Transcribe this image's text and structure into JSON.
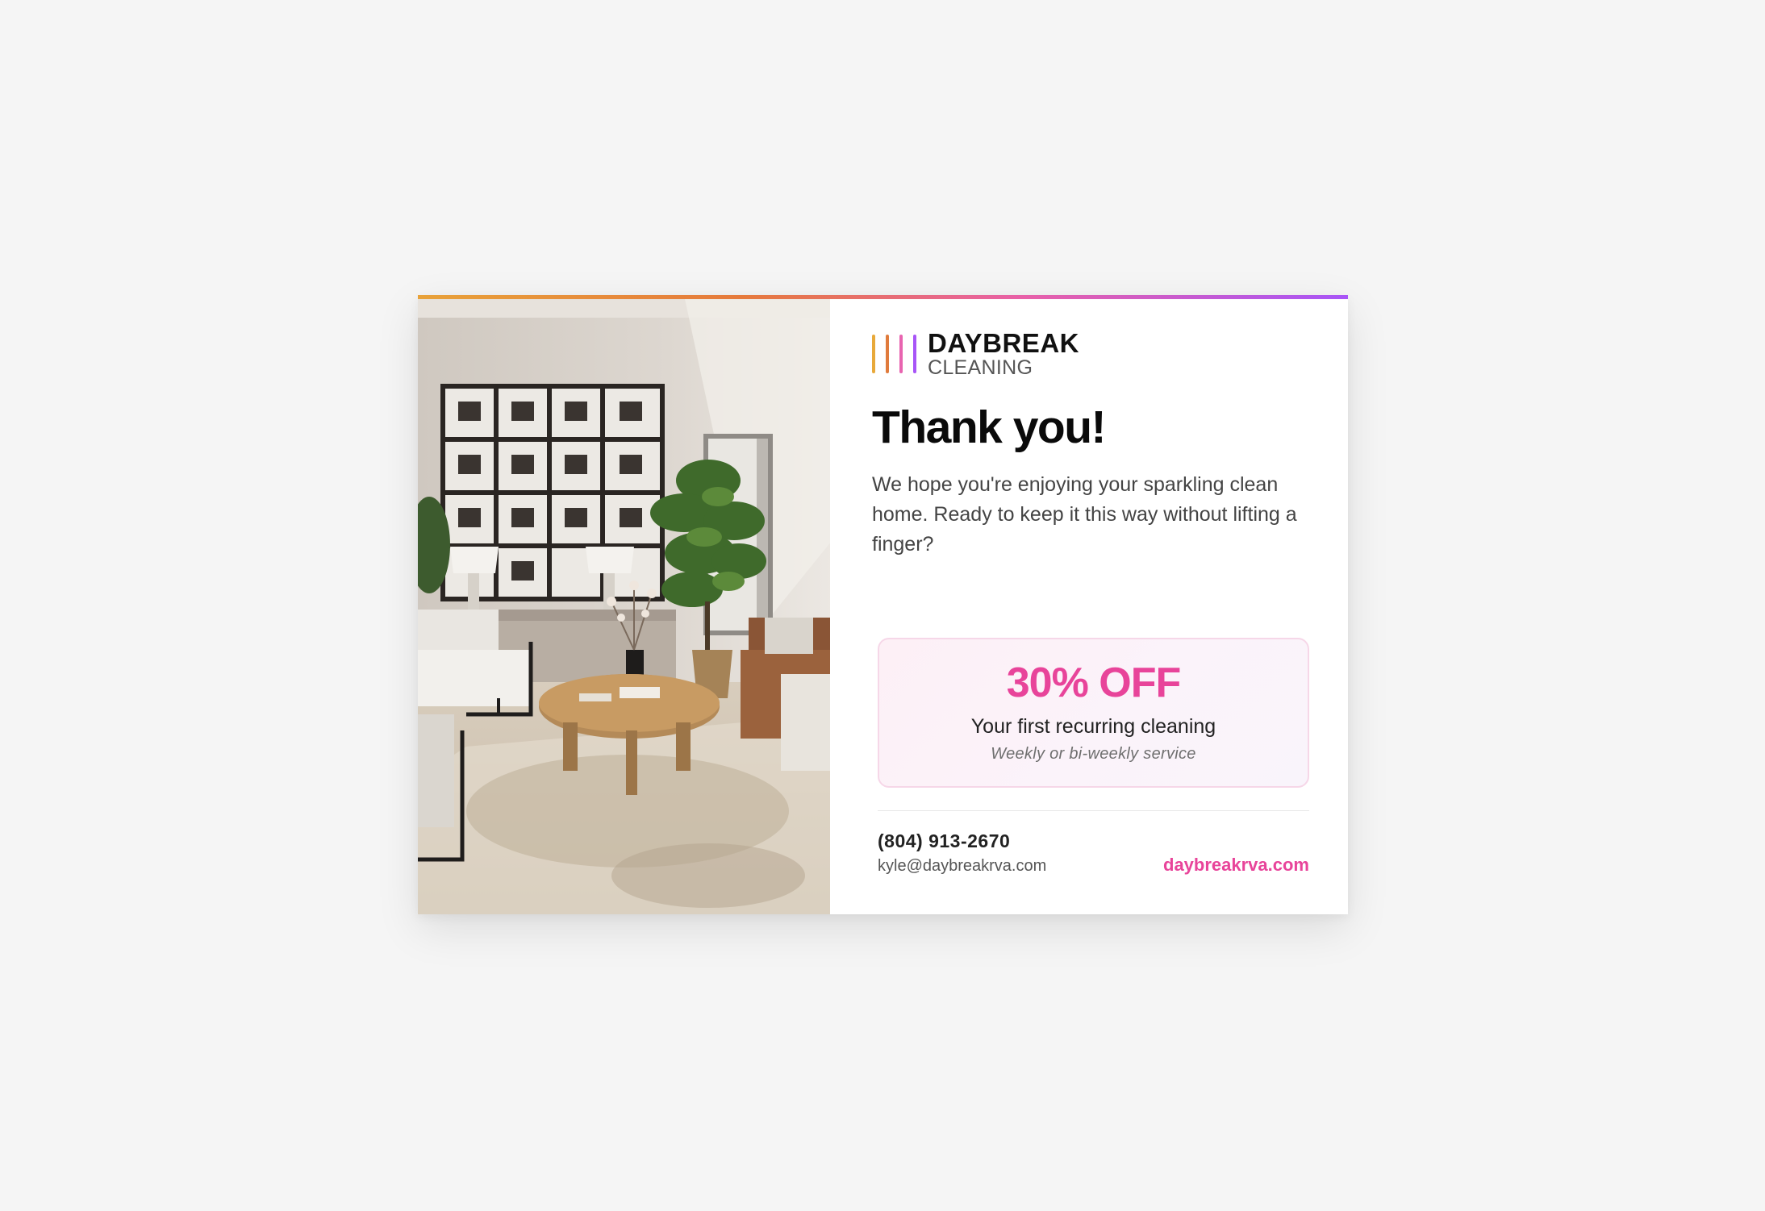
{
  "brand": {
    "name": "DAYBREAK",
    "subtitle": "CLEANING",
    "bar_colors": [
      "#e8a93a",
      "#e07b3c",
      "#e864b0",
      "#a855f7"
    ]
  },
  "card": {
    "headline": "Thank you!",
    "intro": "We hope you're enjoying your sparkling clean home. Ready to keep it this way without lifting a finger?"
  },
  "offer": {
    "amount": "30% OFF",
    "description": "Your first recurring cleaning",
    "note": "Weekly or bi-weekly service"
  },
  "contact": {
    "phone": "(804) 913-2670",
    "email": "kyle@daybreakrva.com",
    "website": "daybreakrva.com"
  },
  "colors": {
    "accent": "#e8449a",
    "page_background": "#f5f5f5"
  }
}
